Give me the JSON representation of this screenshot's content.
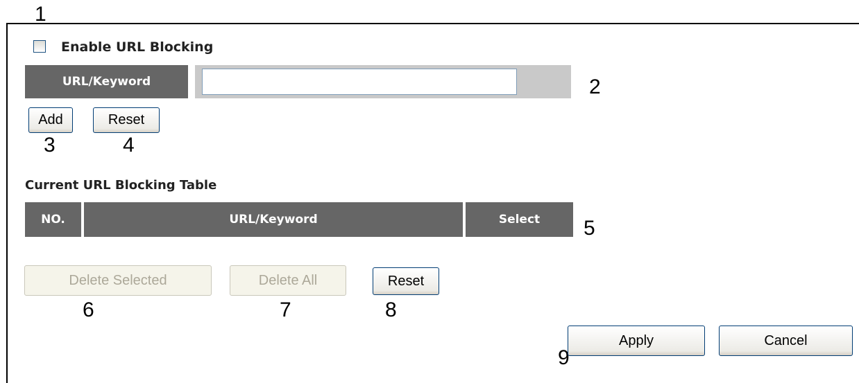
{
  "enable_url_blocking": {
    "label": "Enable URL Blocking",
    "checked": false
  },
  "url_keyword": {
    "label": "URL/Keyword",
    "value": "",
    "placeholder": ""
  },
  "add_button": "Add",
  "reset_button_top": "Reset",
  "table": {
    "title": "Current URL Blocking Table",
    "headers": [
      "NO.",
      "URL/Keyword",
      "Select"
    ],
    "rows": []
  },
  "delete_selected_button": "Delete Selected",
  "delete_all_button": "Delete All",
  "reset_button_bottom": "Reset",
  "apply_button": "Apply",
  "cancel_button": "Cancel",
  "callouts": [
    "1",
    "2",
    "3",
    "4",
    "5",
    "6",
    "7",
    "8",
    "9"
  ]
}
